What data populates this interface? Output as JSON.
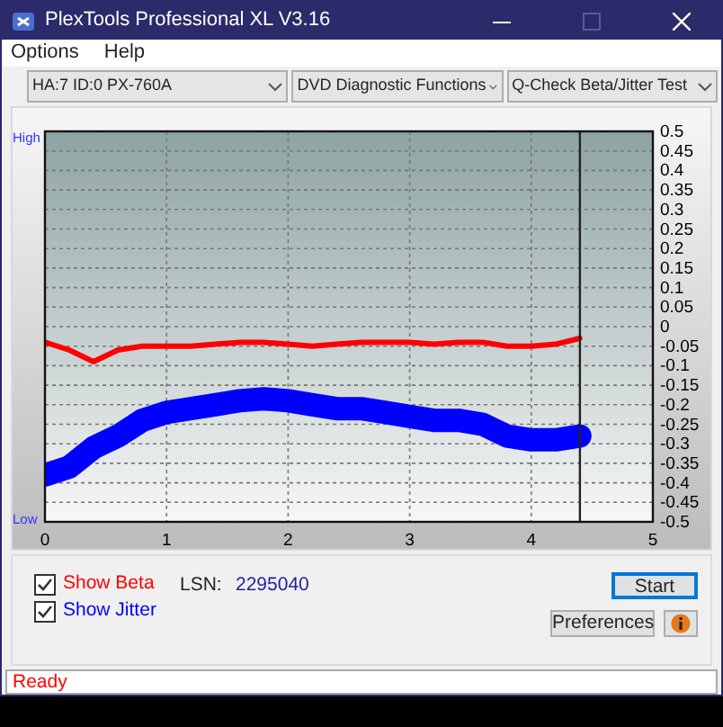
{
  "window": {
    "title": "PlexTools Professional XL V3.16"
  },
  "menu": [
    {
      "label": "Options"
    },
    {
      "label": "Help"
    }
  ],
  "selectors": [
    {
      "value": "HA:7 ID:0  PX-760A"
    },
    {
      "value": "DVD Diagnostic Functions"
    },
    {
      "value": "Q-Check Beta/Jitter Test"
    }
  ],
  "chart": {
    "high_label": "High",
    "low_label": "Low",
    "chart_data": {
      "type": "line",
      "x": [
        0,
        0.2,
        0.4,
        0.6,
        0.8,
        1.0,
        1.2,
        1.4,
        1.6,
        1.8,
        2.0,
        2.2,
        2.4,
        2.6,
        2.8,
        3.0,
        3.2,
        3.4,
        3.6,
        3.8,
        4.0,
        4.2,
        4.4
      ],
      "series": [
        {
          "color": "#ff0000",
          "values": [
            -0.04,
            -0.06,
            -0.09,
            -0.06,
            -0.05,
            -0.05,
            -0.05,
            -0.045,
            -0.04,
            -0.04,
            -0.045,
            -0.05,
            -0.045,
            -0.04,
            -0.04,
            -0.04,
            -0.045,
            -0.04,
            -0.04,
            -0.05,
            -0.05,
            -0.045,
            -0.03
          ]
        },
        {
          "color": "#0000ff",
          "values": [
            -0.38,
            -0.36,
            -0.31,
            -0.28,
            -0.24,
            -0.22,
            -0.21,
            -0.2,
            -0.19,
            -0.185,
            -0.19,
            -0.2,
            -0.21,
            -0.21,
            -0.22,
            -0.23,
            -0.24,
            -0.24,
            -0.25,
            -0.28,
            -0.29,
            -0.29,
            -0.28
          ]
        }
      ],
      "xlim": [
        0,
        5
      ],
      "ylim": [
        -0.5,
        0.5
      ],
      "xticks": [
        0,
        1,
        2,
        3,
        4,
        5
      ],
      "yticks": [
        {
          "value": 0.5,
          "label": "0.5"
        },
        {
          "value": 0.45,
          "label": "0.45"
        },
        {
          "value": 0.4,
          "label": "0.4"
        },
        {
          "value": 0.35,
          "label": "0.35"
        },
        {
          "value": 0.3,
          "label": "0.3"
        },
        {
          "value": 0.25,
          "label": "0.25"
        },
        {
          "value": 0.2,
          "label": "0.2"
        },
        {
          "value": 0.15,
          "label": "0.15"
        },
        {
          "value": 0.1,
          "label": "0.1"
        },
        {
          "value": 0.05,
          "label": "0.05"
        },
        {
          "value": 0,
          "label": "0"
        },
        {
          "value": -0.05,
          "label": "-0.05"
        },
        {
          "value": -0.1,
          "label": "-0.1"
        },
        {
          "value": -0.15,
          "label": "-0.15"
        },
        {
          "value": -0.2,
          "label": "-0.2"
        },
        {
          "value": -0.25,
          "label": "-0.25"
        },
        {
          "value": -0.3,
          "label": "-0.3"
        },
        {
          "value": -0.35,
          "label": "-0.35"
        },
        {
          "value": -0.4,
          "label": "-0.4"
        },
        {
          "value": -0.45,
          "label": "-0.45"
        },
        {
          "value": -0.5,
          "label": "-0.5"
        }
      ],
      "grid": true,
      "ref_lines": [
        {
          "axis": "x",
          "value": 4.4
        }
      ]
    }
  },
  "options": [
    {
      "label": "Show Beta",
      "checked": true,
      "color": "#ff0000"
    },
    {
      "label": "Show Jitter",
      "checked": true,
      "color": "#0000ff"
    }
  ],
  "lsn": {
    "label": "LSN:",
    "value": "2295040"
  },
  "buttons": [
    {
      "label": "Start",
      "kind": "default"
    },
    {
      "label": "Preferences",
      "kind": "plain"
    },
    {
      "kind": "info"
    }
  ],
  "status_bar": {
    "text": "Ready"
  }
}
